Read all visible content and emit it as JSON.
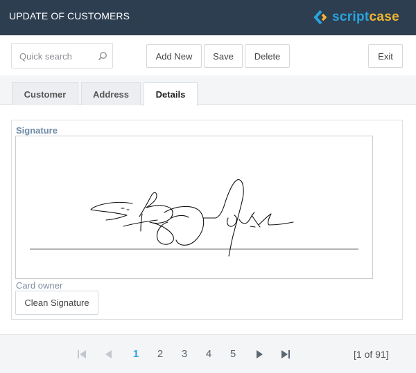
{
  "header": {
    "title": "UPDATE OF CUSTOMERS",
    "logo": {
      "part1": "script",
      "part2": "case",
      "icon": "scriptcase-chevron-icon",
      "color_part1": "#2aa3dd",
      "color_part2": "#f2b632"
    },
    "background": "#2d3e50"
  },
  "toolbar": {
    "search": {
      "placeholder": "Quick search",
      "value": "",
      "icon": "search-icon"
    },
    "add_new_label": "Add New",
    "save_label": "Save",
    "delete_label": "Delete",
    "exit_label": "Exit"
  },
  "tabs": [
    {
      "label": "Customer",
      "active": false
    },
    {
      "label": "Address",
      "active": false
    },
    {
      "label": "Details",
      "active": true
    }
  ],
  "details": {
    "signature_label": "Signature",
    "card_owner_label": "Card owner",
    "clean_signature_label": "Clean Signature"
  },
  "pagination": {
    "pages": [
      "1",
      "2",
      "3",
      "4",
      "5"
    ],
    "current_page": "1",
    "record_info": "[1 of 91]",
    "icons": [
      "first-page-icon",
      "previous-page-icon",
      "next-page-icon",
      "last-page-icon"
    ]
  },
  "colors": {
    "accent": "#2aa3dd",
    "label_blue": "#6f8ba8",
    "footer_bg": "#f4f5f7"
  }
}
